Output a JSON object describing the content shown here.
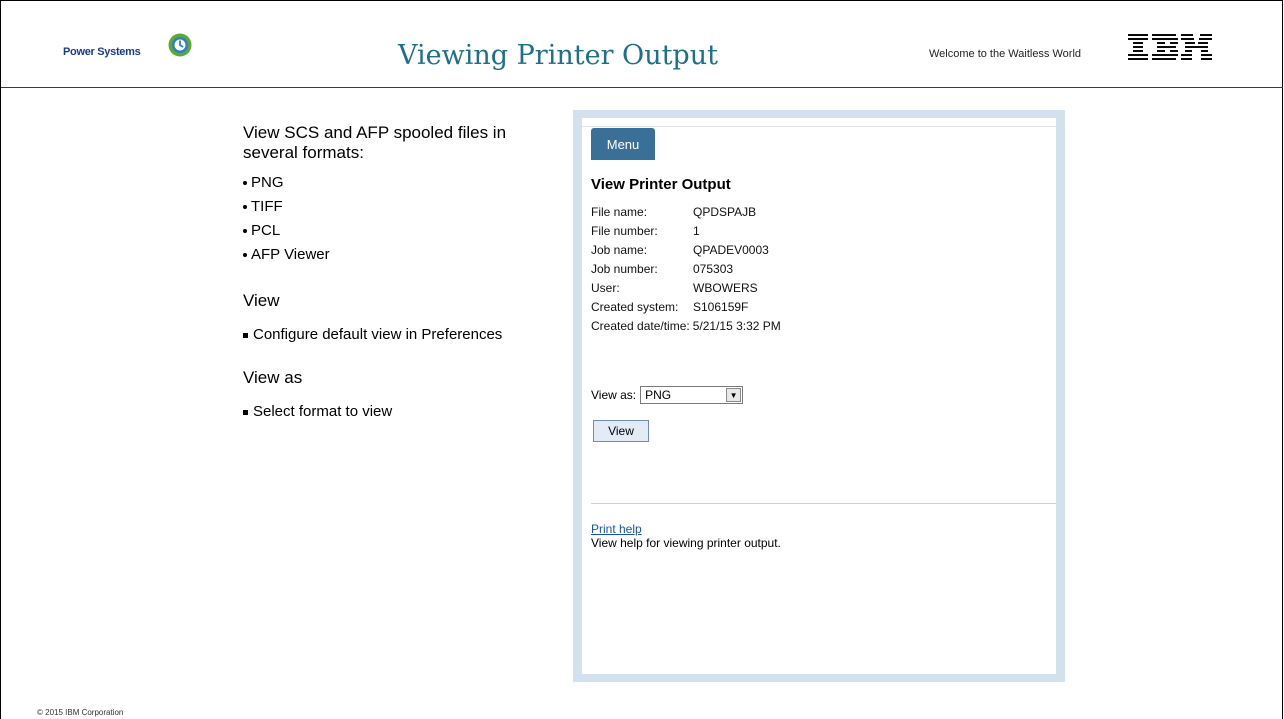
{
  "header": {
    "brand": "Power Systems",
    "title": "Viewing Printer Output",
    "tagline": "Welcome to the Waitless World",
    "company_logo": "IBM"
  },
  "left": {
    "intro": "View SCS and AFP spooled files in several formats:",
    "formats": [
      "PNG",
      "TIFF",
      "PCL",
      "AFP Viewer"
    ],
    "section_view_heading": "View",
    "section_view_text": "Configure default view in Preferences",
    "section_viewas_heading": "View as",
    "section_viewas_text": "Select format to view"
  },
  "panel": {
    "menu_label": "Menu",
    "title": "View Printer Output",
    "properties": [
      {
        "label": "File name:",
        "value": "QPDSPAJB"
      },
      {
        "label": "File number:",
        "value": "1"
      },
      {
        "label": "Job name:",
        "value": "QPADEV0003"
      },
      {
        "label": "Job number:",
        "value": "075303"
      },
      {
        "label": "User:",
        "value": "WBOWERS"
      },
      {
        "label": "Created system:",
        "value": "S106159F"
      },
      {
        "label": "Created date/time:",
        "value": "5/21/15 3:32 PM"
      }
    ],
    "view_as_label": "View as:",
    "view_as_selected": "PNG",
    "view_button": "View",
    "help_link": "Print help",
    "help_text": "View help for viewing printer output."
  },
  "footer": {
    "copyright": "© 2015 IBM Corporation"
  },
  "colors": {
    "title": "#1f6f86",
    "menu": "#3a6f97",
    "panel_border": "#d3e1ef",
    "link": "#1a55a0"
  }
}
